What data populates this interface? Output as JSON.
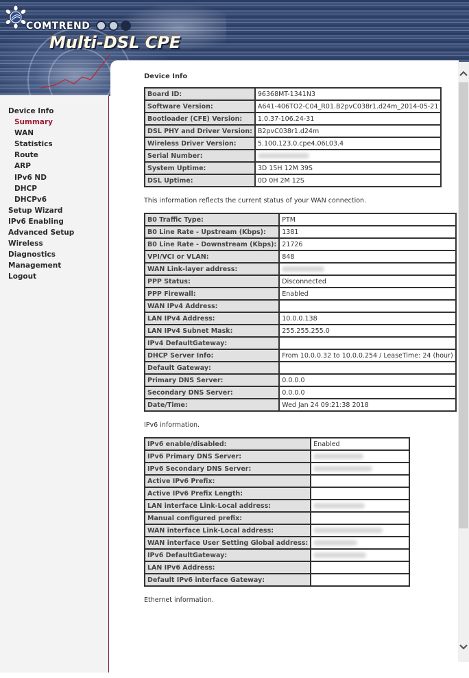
{
  "header": {
    "brand": "COMTREND",
    "product": "Multi-DSL CPE"
  },
  "sidebar": {
    "items": [
      {
        "label": "Device Info",
        "level": 0,
        "active": false
      },
      {
        "label": "Summary",
        "level": 1,
        "active": true
      },
      {
        "label": "WAN",
        "level": 1,
        "active": false
      },
      {
        "label": "Statistics",
        "level": 1,
        "active": false
      },
      {
        "label": "Route",
        "level": 1,
        "active": false
      },
      {
        "label": "ARP",
        "level": 1,
        "active": false
      },
      {
        "label": "IPv6 ND",
        "level": 1,
        "active": false
      },
      {
        "label": "DHCP",
        "level": 1,
        "active": false
      },
      {
        "label": "DHCPv6",
        "level": 1,
        "active": false
      },
      {
        "label": "Setup Wizard",
        "level": 0,
        "active": false
      },
      {
        "label": "IPv6 Enabling",
        "level": 0,
        "active": false
      },
      {
        "label": "Advanced Setup",
        "level": 0,
        "active": false
      },
      {
        "label": "Wireless",
        "level": 0,
        "active": false
      },
      {
        "label": "Diagnostics",
        "level": 0,
        "active": false
      },
      {
        "label": "Management",
        "level": 0,
        "active": false
      },
      {
        "label": "Logout",
        "level": 0,
        "active": false
      }
    ]
  },
  "main": {
    "title": "Device Info",
    "device_table": [
      {
        "label": "Board ID:",
        "value": "96368MT-1341N3"
      },
      {
        "label": "Software Version:",
        "value": "A641-406TO2-C04_R01.B2pvC038r1.d24m_2014-05-21"
      },
      {
        "label": "Bootloader (CFE) Version:",
        "value": "1.0.37-106.24-31"
      },
      {
        "label": "DSL PHY and Driver Version:",
        "value": "B2pvC038r1.d24m"
      },
      {
        "label": "Wireless Driver Version:",
        "value": "5.100.123.0.cpe4.06L03.4"
      },
      {
        "label": "Serial Number:",
        "value": "",
        "redacted": true
      },
      {
        "label": "System Uptime:",
        "value": "3D 15H 12M 39S"
      },
      {
        "label": "DSL Uptime:",
        "value": "0D 0H 2M 12S"
      }
    ],
    "wan_note": "This information reflects the current status of your WAN connection.",
    "wan_table": [
      {
        "label": "B0 Traffic Type:",
        "value": "PTM"
      },
      {
        "label": "B0 Line Rate - Upstream (Kbps):",
        "value": "1381"
      },
      {
        "label": "B0 Line Rate - Downstream (Kbps):",
        "value": "21726"
      },
      {
        "label": "VPI/VCI or VLAN:",
        "value": "848"
      },
      {
        "label": "WAN Link-layer address:",
        "value": "",
        "redacted": true
      },
      {
        "label": "PPP Status:",
        "value": "Disconnected"
      },
      {
        "label": "PPP Firewall:",
        "value": "Enabled"
      },
      {
        "label": "WAN IPv4 Address:",
        "value": ""
      },
      {
        "label": "LAN IPv4 Address:",
        "value": "10.0.0.138"
      },
      {
        "label": "LAN IPv4 Subnet Mask:",
        "value": "255.255.255.0"
      },
      {
        "label": "IPv4 DefaultGateway:",
        "value": ""
      },
      {
        "label": "DHCP Server Info:",
        "value": "From 10.0.0.32 to 10.0.0.254 / LeaseTime: 24 (hour)"
      },
      {
        "label": "Default Gateway:",
        "value": ""
      },
      {
        "label": "Primary DNS Server:",
        "value": "0.0.0.0"
      },
      {
        "label": "Secondary DNS Server:",
        "value": "0.0.0.0"
      },
      {
        "label": "Date/Time:",
        "value": "Wed Jan 24 09:21:38 2018"
      }
    ],
    "ipv6_note": "IPv6 information.",
    "ipv6_table": [
      {
        "label": "IPv6 enable/disabled:",
        "value": "Enabled"
      },
      {
        "label": "IPv6 Primary DNS Server:",
        "value": "",
        "redacted": true
      },
      {
        "label": "IPv6 Secondary DNS Server:",
        "value": "",
        "redacted": true
      },
      {
        "label": "Active IPv6 Prefix:",
        "value": ""
      },
      {
        "label": "Active IPv6 Prefix Length:",
        "value": ""
      },
      {
        "label": "LAN interface Link-Local address:",
        "value": "",
        "redacted": true
      },
      {
        "label": "Manual configured prefix:",
        "value": ""
      },
      {
        "label": "WAN interface Link-Local address:",
        "value": "",
        "redacted": true
      },
      {
        "label": "WAN interface User Setting Global address:",
        "value": "",
        "redacted": true
      },
      {
        "label": "IPv6 DefaultGateway:",
        "value": "",
        "redacted": true
      },
      {
        "label": "LAN IPv6 Address:",
        "value": ""
      },
      {
        "label": "Default IPv6 interface Gateway:",
        "value": ""
      }
    ],
    "ethernet_note": "Ethernet information."
  },
  "scrollbar": {
    "up_icon": "chevron-up-icon",
    "down_icon": "chevron-down-icon",
    "position_fraction": 0.0
  }
}
